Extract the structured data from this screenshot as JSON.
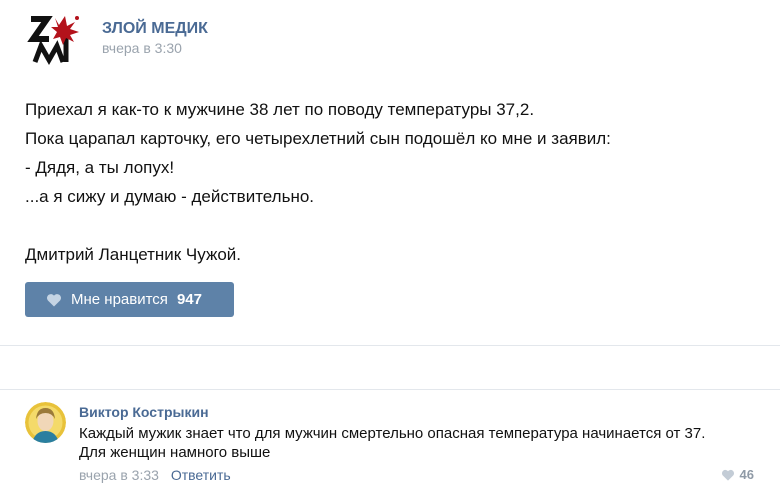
{
  "post": {
    "author": "ЗЛОЙ МЕДИК",
    "time": "вчера в 3:30",
    "lines": [
      "Приехал я как-то к мужчине 38 лет по поводу температуры 37,2.",
      "Пока царапал карточку, его четырехлетний сын подошёл ко мне и заявил:",
      "- Дядя, а ты лопух!",
      "...а я сижу и думаю - действительно.",
      "",
      "Дмитрий Ланцетник Чужой."
    ],
    "like_label": "Мне нравится",
    "like_count": "947"
  },
  "comment": {
    "author": "Виктор Кострыкин",
    "text_lines": [
      "Каждый мужик знает что для мужчин смертельно опасная температура начинается от 37.",
      "Для женщин намного выше"
    ],
    "time": "вчера в 3:33",
    "reply_label": "Ответить",
    "likes": "46"
  },
  "icons": {
    "logo": "zm-logo-with-blood-splat",
    "like": "heart-icon",
    "avatar": "golden-avatar"
  },
  "colors": {
    "link": "#4a6a94",
    "like_button": "#5e82a8",
    "muted": "#9aa3ad"
  }
}
